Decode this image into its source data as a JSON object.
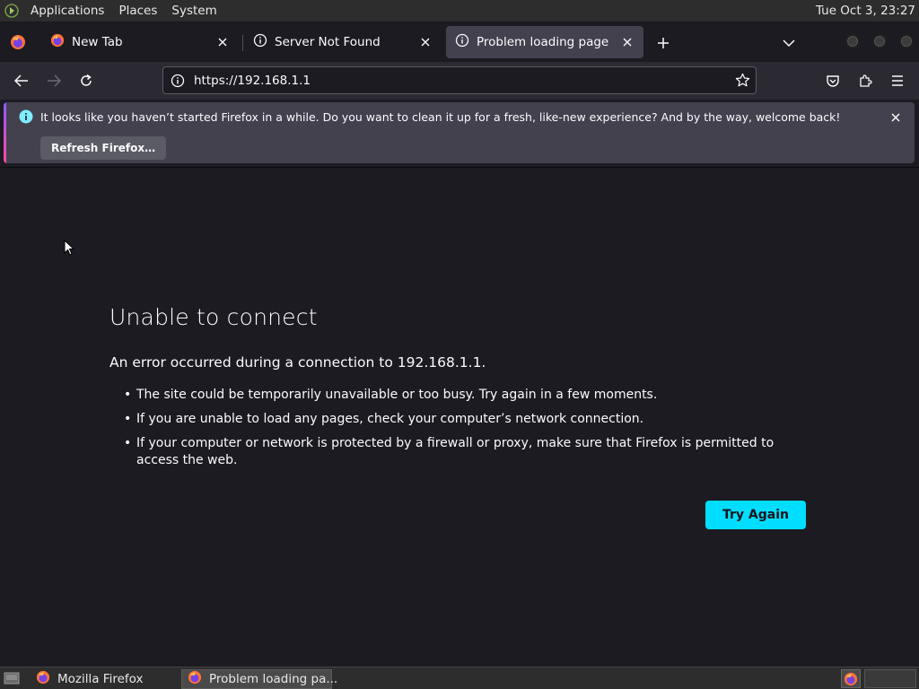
{
  "top_panel": {
    "menus": [
      "Applications",
      "Places",
      "System"
    ],
    "clock": "Tue Oct  3, 23:27"
  },
  "tabs": [
    {
      "label": "New Tab",
      "icon": "firefox-icon"
    },
    {
      "label": "Server Not Found",
      "icon": "info-icon"
    },
    {
      "label": "Problem loading page",
      "icon": "info-icon",
      "selected": true
    }
  ],
  "urlbar": {
    "url": "https://192.168.1.1"
  },
  "notification": {
    "message": "It looks like you haven’t started Firefox in a while. Do you want to clean it up for a fresh, like-new experience? And by the way, welcome back!",
    "button_label": "Refresh Firefox…"
  },
  "error_page": {
    "title": "Unable to connect",
    "description": "An error occurred during a connection to 192.168.1.1.",
    "bullets": [
      "The site could be temporarily unavailable or too busy. Try again in a few moments.",
      "If you are unable to load any pages, check your computer’s network connection.",
      "If your computer or network is protected by a firewall or proxy, make sure that Firefox is permitted to access the web."
    ],
    "button_label": "Try Again"
  },
  "taskbar": {
    "items": [
      {
        "label": "Mozilla Firefox"
      },
      {
        "label": "Problem loading pa..."
      }
    ]
  },
  "colors": {
    "accent_button": "#00ddff",
    "page_bg": "#1c1b22",
    "toolbar_bg": "#2b2a33",
    "notification_bg": "#42414d"
  }
}
